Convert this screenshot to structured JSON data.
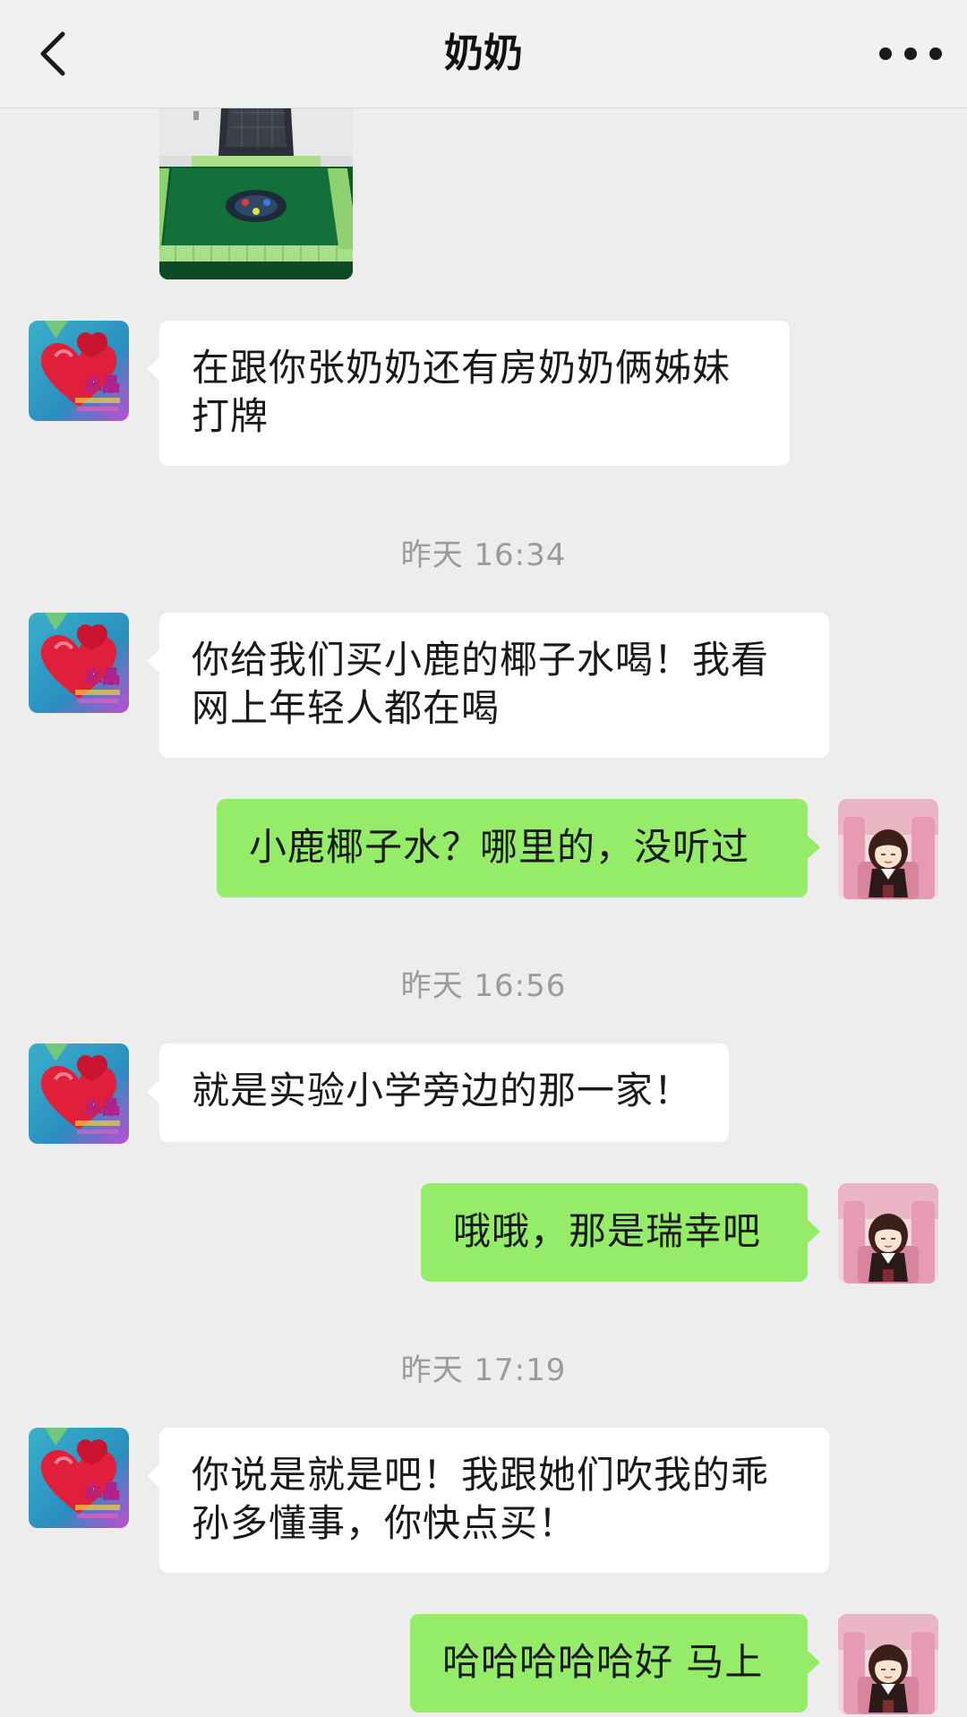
{
  "header": {
    "title": "奶奶",
    "back_icon": "chevron-left-icon",
    "more_icon": "more-horizontal-icon"
  },
  "colors": {
    "header_bg": "#f1f1f1",
    "chat_bg": "#ededed",
    "incoming_bubble": "#ffffff",
    "outgoing_bubble": "#95ec69",
    "timestamp_text": "#9b9b9b"
  },
  "messages": [
    {
      "type": "image",
      "sender": "grandma",
      "description_icon": "mahjong-table-photo"
    },
    {
      "type": "text",
      "sender": "grandma",
      "text": "在跟你张奶奶还有房奶奶俩姊妹\n打牌"
    },
    {
      "type": "timestamp",
      "text": "昨天 16:34"
    },
    {
      "type": "text",
      "sender": "grandma",
      "text": "你给我们买小鹿的椰子水喝！我看\n网上年轻人都在喝"
    },
    {
      "type": "text",
      "sender": "me",
      "text": "小鹿椰子水？哪里的，没听过"
    },
    {
      "type": "timestamp",
      "text": "昨天 16:56"
    },
    {
      "type": "text",
      "sender": "grandma",
      "text": "就是实验小学旁边的那一家！"
    },
    {
      "type": "text",
      "sender": "me",
      "text": "哦哦，那是瑞幸吧"
    },
    {
      "type": "timestamp",
      "text": "昨天 17:19"
    },
    {
      "type": "text",
      "sender": "grandma",
      "text": "你说是就是吧！我跟她们吹我的乖\n孙多懂事，你快点买！"
    },
    {
      "type": "text",
      "sender": "me",
      "text": "哈哈哈哈哈好 马上"
    }
  ]
}
